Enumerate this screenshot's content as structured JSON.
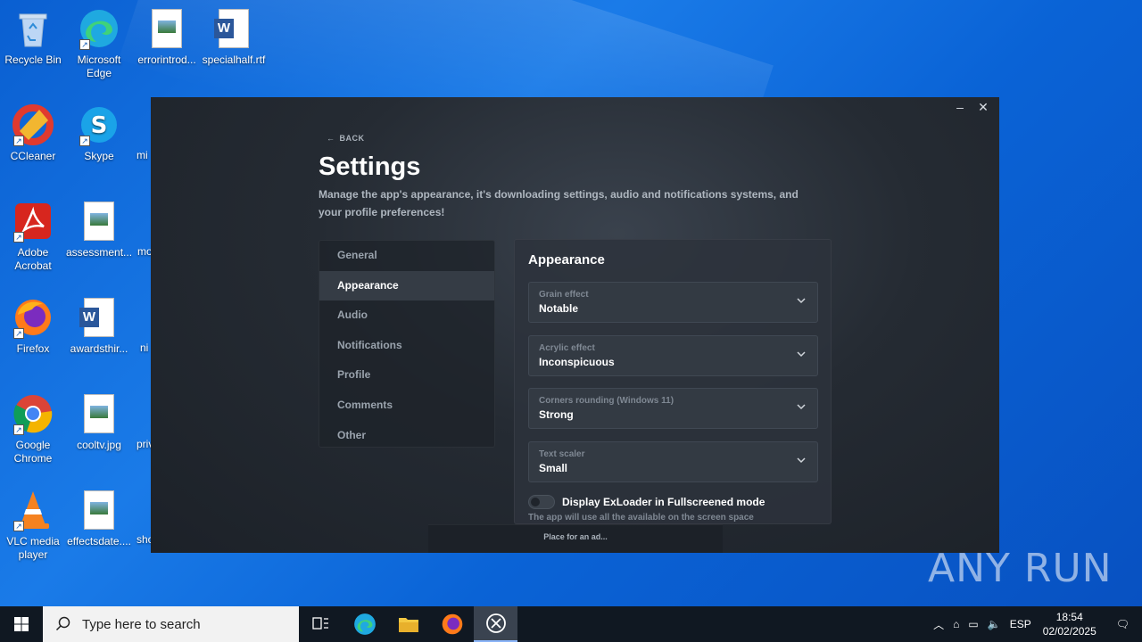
{
  "desktop": {
    "icons": [
      {
        "label": "Recycle Bin"
      },
      {
        "label": "Microsoft Edge"
      },
      {
        "label": "errorintrod..."
      },
      {
        "label": "specialhalf.rtf"
      },
      {
        "label": "CCleaner"
      },
      {
        "label": "Skype"
      },
      {
        "label": "Adobe Acrobat"
      },
      {
        "label": "assessment..."
      },
      {
        "label": "Firefox"
      },
      {
        "label": "awardsthir..."
      },
      {
        "label": "Google Chrome"
      },
      {
        "label": "cooltv.jpg"
      },
      {
        "label": "VLC media player"
      },
      {
        "label": "effectsdate...."
      }
    ],
    "partial_labels": [
      "mi",
      "mo",
      "ni",
      "priv",
      "sho"
    ]
  },
  "app": {
    "back_label": "BACK",
    "title": "Settings",
    "description": "Manage the app's appearance, it's downloading settings, audio and notifications systems, and your profile preferences!",
    "nav": [
      {
        "label": "General"
      },
      {
        "label": "Appearance"
      },
      {
        "label": "Audio"
      },
      {
        "label": "Notifications"
      },
      {
        "label": "Profile"
      },
      {
        "label": "Comments"
      },
      {
        "label": "Other"
      }
    ],
    "active_nav": "Appearance",
    "panel": {
      "title": "Appearance",
      "selects": [
        {
          "label": "Grain effect",
          "value": "Notable"
        },
        {
          "label": "Acrylic effect",
          "value": "Inconspicuous"
        },
        {
          "label": "Corners rounding (Windows 11)",
          "value": "Strong"
        },
        {
          "label": "Text scaler",
          "value": "Small"
        }
      ],
      "toggle": {
        "label": "Display ExLoader in Fullscreened mode",
        "description": "The app will use all the available on the screen space",
        "on": false
      }
    },
    "ad_text": "Place for an ad..."
  },
  "watermark": "ANY RUN",
  "taskbar": {
    "search_placeholder": "Type here to search",
    "language": "ESP",
    "time": "18:54",
    "date": "02/02/2025"
  },
  "colors": {
    "desktop_blue": "#1a7be8",
    "app_bg": "#252b33",
    "taskbar_bg": "#101822"
  }
}
